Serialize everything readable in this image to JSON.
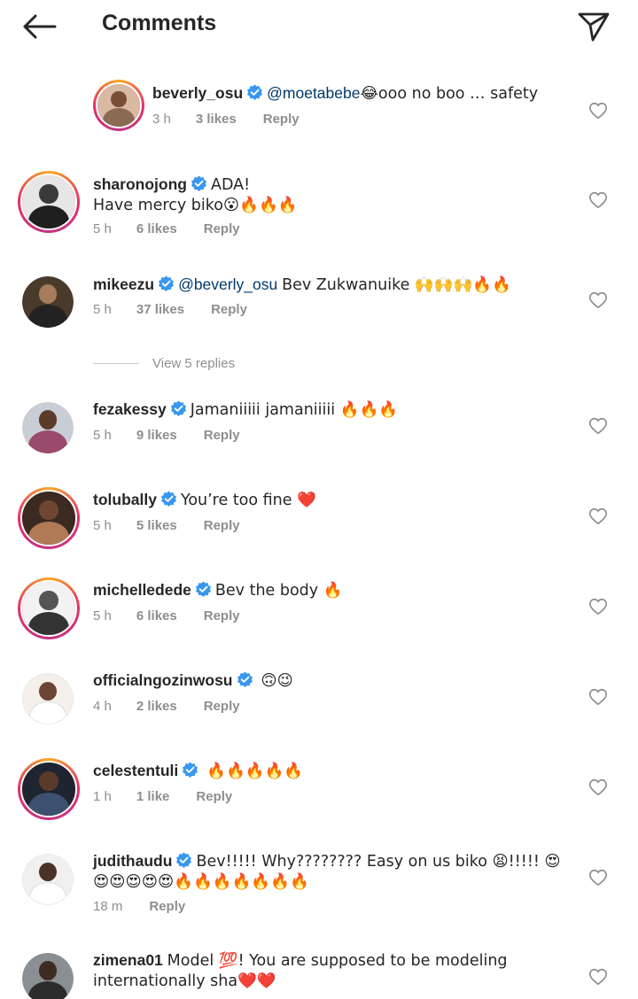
{
  "header": {
    "title": "Comments",
    "back_icon": "arrow-left-icon",
    "send_icon": "paper-plane-icon"
  },
  "colors": {
    "verified": "#3897f0",
    "mention": "#00376b",
    "meta": "#8e8e8e",
    "text": "#262626",
    "story_ring_start": "#f9a826",
    "story_ring_end": "#c13584"
  },
  "comments": [
    {
      "username": "beverly_osu",
      "verified": true,
      "mention": "@moetabebe",
      "text": "😂ooo no boo … safety",
      "time": "3 h",
      "likes": "3 likes",
      "reply": "Reply"
    },
    {
      "username": "sharonojong",
      "verified": true,
      "mention": "",
      "text": "ADA!\nHave mercy biko😮🔥🔥🔥",
      "time": "5 h",
      "likes": "6 likes",
      "reply": "Reply"
    },
    {
      "username": "mikeezu",
      "verified": true,
      "mention": "@beverly_osu",
      "text": "Bev Zukwanuike 🙌🙌🙌🔥🔥",
      "time": "5 h",
      "likes": "37 likes",
      "reply": "Reply"
    },
    {
      "username": "fezakessy",
      "verified": true,
      "mention": "",
      "text": "Jamaniiiii jamaniiiii 🔥🔥🔥",
      "time": "5 h",
      "likes": "9 likes",
      "reply": "Reply"
    },
    {
      "username": "tolubally",
      "verified": true,
      "mention": "",
      "text": "You’re too fine ❤️",
      "time": "5 h",
      "likes": "5 likes",
      "reply": "Reply"
    },
    {
      "username": "michelledede",
      "verified": true,
      "mention": "",
      "text": "Bev the body 🔥",
      "time": "5 h",
      "likes": "6 likes",
      "reply": "Reply"
    },
    {
      "username": "officialngozinwosu",
      "verified": true,
      "mention": "",
      "text": "🙃😉",
      "time": "4 h",
      "likes": "2 likes",
      "reply": "Reply"
    },
    {
      "username": "celestentuli",
      "verified": true,
      "mention": "",
      "text": "🔥🔥🔥🔥🔥",
      "time": "1 h",
      "likes": "1 like",
      "reply": "Reply"
    },
    {
      "username": "judithaudu",
      "verified": true,
      "mention": "",
      "text": "Bev!!!!! Why???????? Easy on us biko 😫!!!!! 😍😍😍😍😍😍🔥🔥🔥🔥🔥🔥🔥",
      "time": "18 m",
      "likes": "",
      "reply": "Reply"
    },
    {
      "username": "zimena01",
      "verified": false,
      "mention": "",
      "text": "Model 💯! You are supposed to be modeling internationally sha❤️❤️",
      "time": "",
      "likes": "",
      "reply": ""
    }
  ],
  "view_replies": "View 5 replies"
}
